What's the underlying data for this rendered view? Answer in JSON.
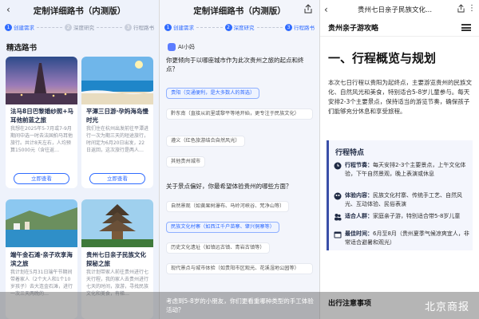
{
  "panel1": {
    "title": "定制详细路书（内测版）",
    "back_icon": "‹",
    "steps": [
      {
        "num": "1",
        "label": "创建需求"
      },
      {
        "num": "2",
        "label": "深度研究"
      },
      {
        "num": "3",
        "label": "行程路书"
      }
    ],
    "section_title": "精选路书",
    "cards": [
      {
        "title": "法马8日巴黎婚纱照+马耳他前蓝之旅",
        "desc": "我想在2025年5-7月或7-9月期间中选一时去法国拍马耳他旅行。共计8天左右，人均预算15000元（含往返…",
        "button": "立即查看"
      },
      {
        "title": "平潭三日游·孕妈海岛慢时光",
        "desc": "我们住在杭州出发前往平潭进行一次为期三天的短途旅行，时间定为6月20日出发，22日返回，这次旅行是两人…",
        "button": "立即查看"
      },
      {
        "title": "端午金石滩·亲子欢享海滨之旅",
        "desc": "我计划在5月31日端午节期间带着家人（2个大人和1个10岁孩子）去大连金石滩，进行一次三天两晚的…",
        "button": "立即查看"
      },
      {
        "title": "贵州七日亲子民族文化探秘之旅",
        "desc": "我计划带家人前往贵州进行七天行程，我的家人去贵州进行七天的时间，旅游，寻找民族文化和美食，有梯…",
        "button": "立即查看"
      }
    ]
  },
  "panel2": {
    "title": "定制详细路书（内测版）",
    "ai_name": "AI小妈",
    "q1": "你更倾向于以哪座城市作为此次贵州之旅的起点和终点？",
    "q1_options": [
      "贵阳（交通便利，是大多数人的首选）",
      "黔东南（直接从凯里或黎平等地开始，更专注于民族文化）",
      "遵义（红色旅游结合自然风光）",
      "其他贵州城市"
    ],
    "q2": "关于景点偏好，你最希望体验贵州的哪些方面？",
    "q2_options": [
      "自然景观（如黄果树瀑布、马岭河峡谷、梵净山等）",
      "民族文化村寨（如西江千户苗寨、肇兴侗寨等）",
      "历史文化遗址（如镇远古镇、青岩古镇等）",
      "现代景点与城市体验（如贵阳市区观光、花溪湿地公园等）"
    ],
    "q3": "考虑到5-8岁的小朋友，你们更看重哪种类型的手工体验活动？"
  },
  "panel3": {
    "title": "贵州七日亲子民族文化...",
    "doc_title": "贵州亲子游攻略",
    "h1": "一、行程概览与规划",
    "para": "本次七日行程以贵阳为起终点，主要游览贵州的民族文化、自然风光和美食，特别适合5-8岁儿童参与。每天安排2-3个主要景点，保持适当的游览节奏，确保孩子们能够充分休息和享受旅程。",
    "box_title": "行程特点",
    "features": [
      {
        "label": "行程节奏：",
        "text": "每天安排2-3个主要景点，上午文化体验，下午自然景观，晚上表演或休息"
      },
      {
        "label": "体验内容：",
        "text": "民族文化村寨、传统手工艺、自然风光、互动体验、民俗表演"
      },
      {
        "label": "适合人群：",
        "text": "家庭亲子游，特别适合带5-8岁儿童"
      },
      {
        "label": "最佳时间：",
        "text": "6月至8月（贵州夏季气候凉爽宜人，非常适合避暑和观光）"
      }
    ],
    "h2": "出行注意事项"
  },
  "watermark": "北京商报",
  "colors": {
    "accent": "#2f6bff",
    "navy": "#1f2a44",
    "box_bg": "#f4f6fd"
  }
}
